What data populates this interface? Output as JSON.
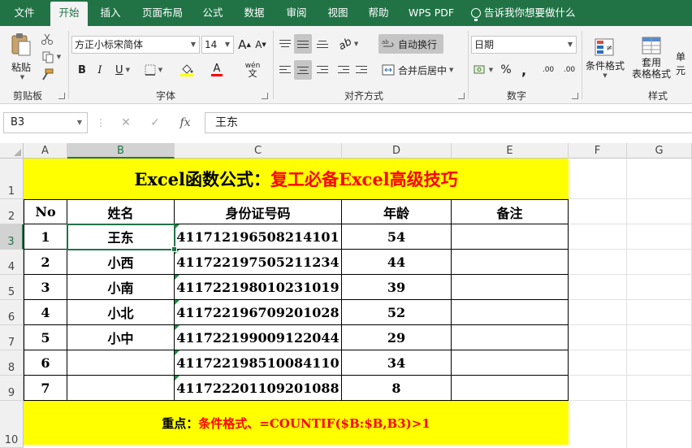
{
  "tabs": [
    "文件",
    "开始",
    "插入",
    "页面布局",
    "公式",
    "数据",
    "审阅",
    "视图",
    "帮助",
    "WPS PDF"
  ],
  "active_tab": "开始",
  "tell_me": "告诉我你想要做什么",
  "ribbon": {
    "clipboard": {
      "paste": "粘贴",
      "label": "剪贴板"
    },
    "font": {
      "name": "方正小标宋简体",
      "size": "14",
      "bold": "B",
      "italic": "I",
      "underline": "U",
      "grow": "A",
      "shrink": "A",
      "font_color_glyph": "A",
      "phonetic": "wén",
      "label": "字体"
    },
    "alignment": {
      "wrap_text": "自动换行",
      "merge_center": "合并后居中",
      "label": "对齐方式"
    },
    "number": {
      "format": "日期",
      "percent": "%",
      "comma": ",",
      "inc_decimal": ".00",
      "dec_decimal": ".00",
      "label": "数字"
    },
    "styles": {
      "conditional": "条件格式",
      "table_format_1": "套用",
      "table_format_2": "表格格式",
      "cell_styles": "单元",
      "label": "样式"
    }
  },
  "formula_bar": {
    "name_box": "B3",
    "cancel": "✕",
    "enter": "✓",
    "fx": "fx",
    "content": "王东"
  },
  "columns": [
    "A",
    "B",
    "C",
    "D",
    "E",
    "F",
    "G"
  ],
  "rows": [
    "1",
    "2",
    "3",
    "4",
    "5",
    "6",
    "7",
    "8",
    "9",
    "10"
  ],
  "sheet": {
    "title_black": "Excel函数公式：",
    "title_red": "复工必备Excel高级技巧",
    "headers": [
      "No",
      "姓名",
      "身份证号码",
      "年龄",
      "备注"
    ],
    "rows": [
      {
        "no": "1",
        "name": "王东",
        "id": "411712196508214101",
        "age": "54",
        "note": ""
      },
      {
        "no": "2",
        "name": "小西",
        "id": "411722197505211234",
        "age": "44",
        "note": ""
      },
      {
        "no": "3",
        "name": "小南",
        "id": "411722198010231019",
        "age": "39",
        "note": ""
      },
      {
        "no": "4",
        "name": "小北",
        "id": "411722196709201028",
        "age": "52",
        "note": ""
      },
      {
        "no": "5",
        "name": "小中",
        "id": "411722199009122044",
        "age": "29",
        "note": ""
      },
      {
        "no": "6",
        "name": "",
        "id": "411722198510084110",
        "age": "34",
        "note": ""
      },
      {
        "no": "7",
        "name": "",
        "id": "411722201109201088",
        "age": "8",
        "note": ""
      }
    ],
    "footer_black": "重点：",
    "footer_red": "条件格式、=COUNTIF($B:$B,B3)>1"
  },
  "colors": {
    "excel_green": "#217346",
    "banner_yellow": "#ffff00",
    "accent_red": "#ff0000",
    "error_triangle": "#1e8e3e"
  }
}
